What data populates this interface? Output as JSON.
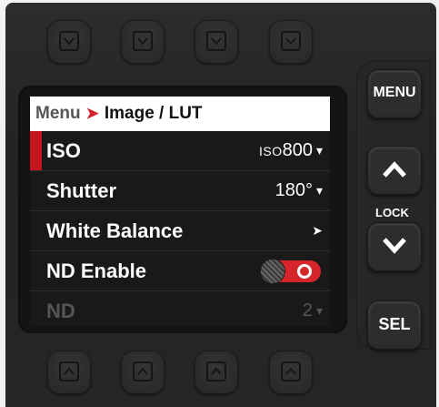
{
  "breadcrumb": {
    "root": "Menu",
    "separator": "➤",
    "current": "Image / LUT"
  },
  "menu": {
    "rows": [
      {
        "label": "ISO",
        "value_prefix": "ISO",
        "value": "800",
        "control": "dropdown",
        "selected": true
      },
      {
        "label": "Shutter",
        "value": "180°",
        "control": "dropdown"
      },
      {
        "label": "White Balance",
        "control": "submenu"
      },
      {
        "label": "ND Enable",
        "control": "toggle",
        "state": "on"
      },
      {
        "label": "ND",
        "value": "2",
        "control": "dropdown",
        "disabled": true
      }
    ]
  },
  "buttons": {
    "menu": "MENU",
    "lock": "LOCK",
    "sel": "SEL"
  },
  "icons": {
    "caret": "▾",
    "submenu": "➤",
    "up": "up-arrow-icon",
    "down": "down-arrow-icon"
  },
  "colors": {
    "accent": "#c4161c",
    "toggle_on": "#d6262c"
  }
}
